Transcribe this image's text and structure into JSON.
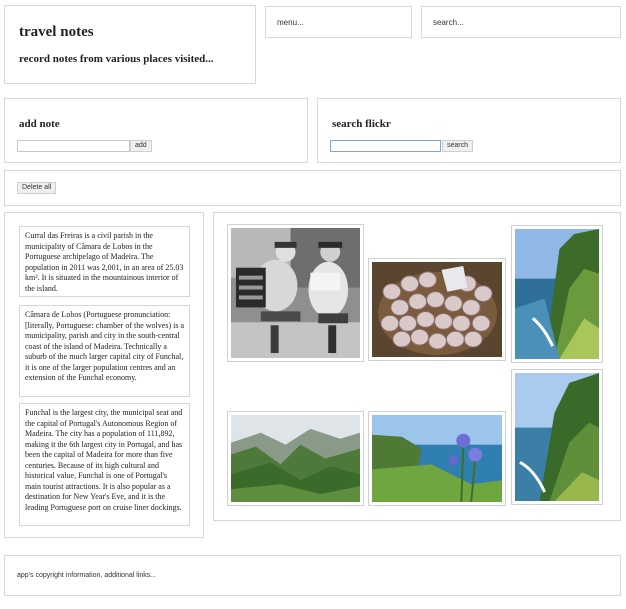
{
  "header": {
    "title": "travel notes",
    "subtitle": "record notes from various places visited..."
  },
  "menu": {
    "label": "menu..."
  },
  "search": {
    "label": "search..."
  },
  "add_note": {
    "title": "add note",
    "input_value": "",
    "button_label": "add"
  },
  "search_flickr": {
    "title": "search flickr",
    "input_value": "",
    "button_label": "search"
  },
  "toolbar": {
    "delete_all_label": "Delete all"
  },
  "notes": [
    {
      "text": "Curral das Freiras is a civil parish in the municipality of Câmara de Lobos in the Portuguese archipelago of Madeira. The population in 2011 was 2,001, in an area of 25.03 km². It is situated in the mountainous interior of the island."
    },
    {
      "text": "Câmara de Lobos (Portuguese pronunciation: [literally, Portuguese: chamber of the wolves) is a municipality, parish and city in the south-central coast of the island of Madeira. Technically a suburb of the much larger capital city of Funchal, it is one of the larger population centres and an extension of the Funchal economy."
    },
    {
      "text": "Funchal is the largest city, the municipal seat and the capital of Portugal's Autonomous Region of Madeira. The city has a population of 111,892, making it the 6th largest city in Portugal, and has been the capital of Madeira for more than five centuries. Because of its high cultural and historical value, Funchal is one of Portugal's main tourist attractions. It is also popular as a destination for New Year's Eve, and it is the leading Portuguese port on cruise liner dockings."
    }
  ],
  "photos": [
    {
      "subject": "men-playing-accordion-bw"
    },
    {
      "subject": "basket-of-garlic"
    },
    {
      "subject": "coastal-cliffs"
    },
    {
      "subject": "green-mountain-valley"
    },
    {
      "subject": "agapanthus-by-sea"
    },
    {
      "subject": "cliff-coastline"
    }
  ],
  "footer": {
    "text": "app's copyright information, additional links..."
  },
  "colors": {
    "border": "#d8d8d8",
    "focus": "#7fa9dc"
  }
}
